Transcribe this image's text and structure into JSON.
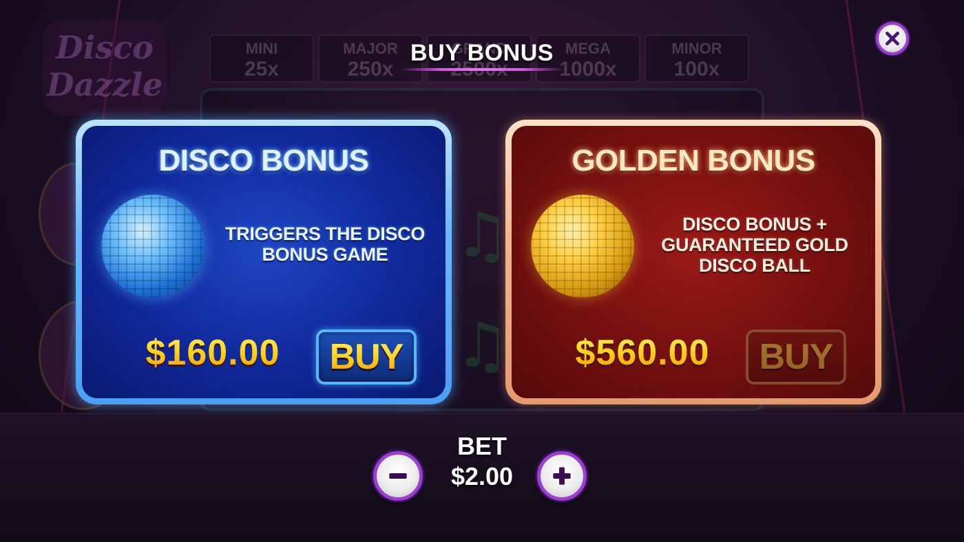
{
  "popup": {
    "title": "BUY BONUS"
  },
  "background": {
    "logo_text": "Disco Dazzle",
    "jackpots": [
      {
        "name": "MINI",
        "value": "25x"
      },
      {
        "name": "MAJOR",
        "value": "250x"
      },
      {
        "name": "GRAND",
        "value": "2500x"
      },
      {
        "name": "MEGA",
        "value": "1000x"
      },
      {
        "name": "MINOR",
        "value": "100x"
      }
    ]
  },
  "offers": [
    {
      "title": "DISCO BONUS",
      "description_lines": [
        "TRIGGERS THE DISCO",
        "BONUS GAME"
      ],
      "price": "$160.00",
      "button_label": "BUY",
      "icon": "blue-disco-ball-icon",
      "state": "enabled"
    },
    {
      "title": "GOLDEN BONUS",
      "description_lines": [
        "DISCO BONUS +",
        "GUARANTEED GOLD",
        "DISCO BALL"
      ],
      "price": "$560.00",
      "button_label": "BUY",
      "icon": "gold-disco-ball-icon",
      "state": "disabled"
    }
  ],
  "bet": {
    "label": "BET",
    "value": "$2.00"
  },
  "icons": {
    "close": "close-icon",
    "minus": "minus-icon",
    "plus": "plus-icon"
  },
  "colors": {
    "accent_purple": "#9a3fd0",
    "disco_blue": "#10289a",
    "golden_red": "#74100f",
    "price_gold": "#ffd21f"
  }
}
